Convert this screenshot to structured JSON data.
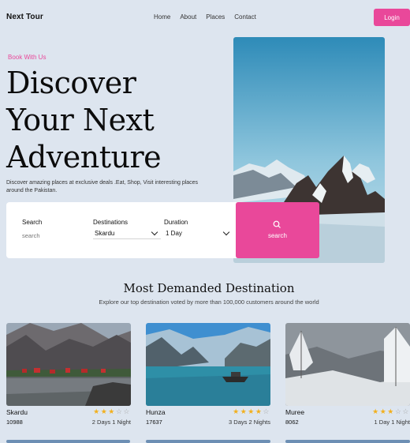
{
  "nav": {
    "brand": "Next Tour",
    "links": [
      "Home",
      "About",
      "Places",
      "Contact"
    ],
    "login_label": "Login"
  },
  "hero": {
    "eyebrow": "Book With Us",
    "headline": [
      "Discover",
      "Your Next",
      "Adventure"
    ],
    "description": "Discover amazing places at exclusive deals .Eat, Shop, Visit interesting places around the Pakistan."
  },
  "search": {
    "search_label": "Search",
    "search_placeholder": "search",
    "destinations_label": "Destinations",
    "destinations_value": "Skardu",
    "duration_label": "Duration",
    "duration_value": "1 Day",
    "button_label": "search"
  },
  "section": {
    "title": "Most Demanded Destination",
    "subtitle": "Explore our top destination voted by more than 100,000 customers around the world"
  },
  "cards": [
    {
      "name": "Skardu",
      "price": "10988",
      "duration": "2 Days 1 Night",
      "rating": 3
    },
    {
      "name": "Hunza",
      "price": "17637",
      "duration": "3 Days 2 Nights",
      "rating": 4
    },
    {
      "name": "Muree",
      "price": "8062",
      "duration": "1 Day 1 Night",
      "rating": 3
    }
  ],
  "colors": {
    "accent": "#e9489a",
    "background": "#dde5ef",
    "star": "#f2b01e"
  }
}
